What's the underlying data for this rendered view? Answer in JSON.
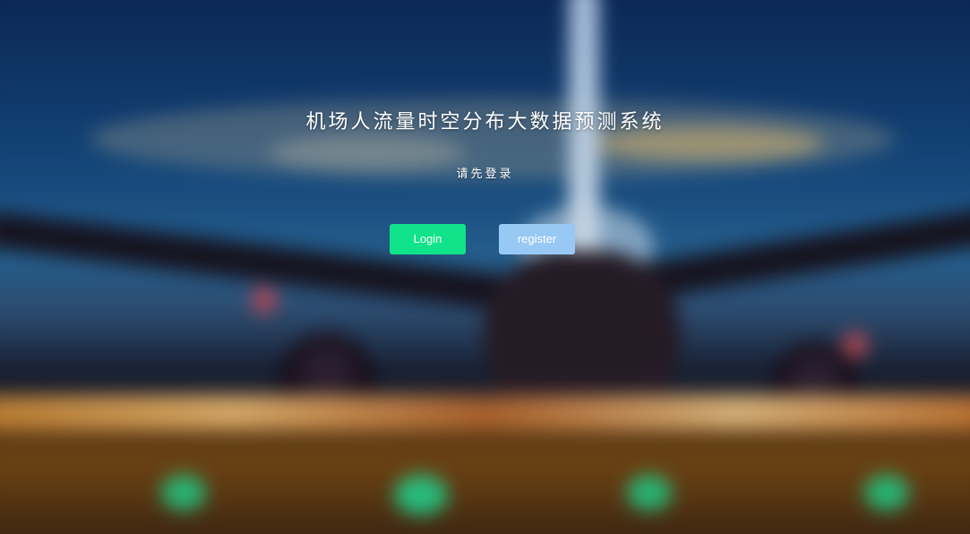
{
  "page": {
    "title": "机场人流量时空分布大数据预测系统",
    "subtitle": "请先登录"
  },
  "actions": {
    "login_label": "Login",
    "register_label": "register"
  },
  "colors": {
    "login_button": "#11e38a",
    "register_button": "#98c8f4",
    "text": "#ffffff"
  },
  "background": {
    "description_icon": "airport-night-airplane-photo"
  }
}
